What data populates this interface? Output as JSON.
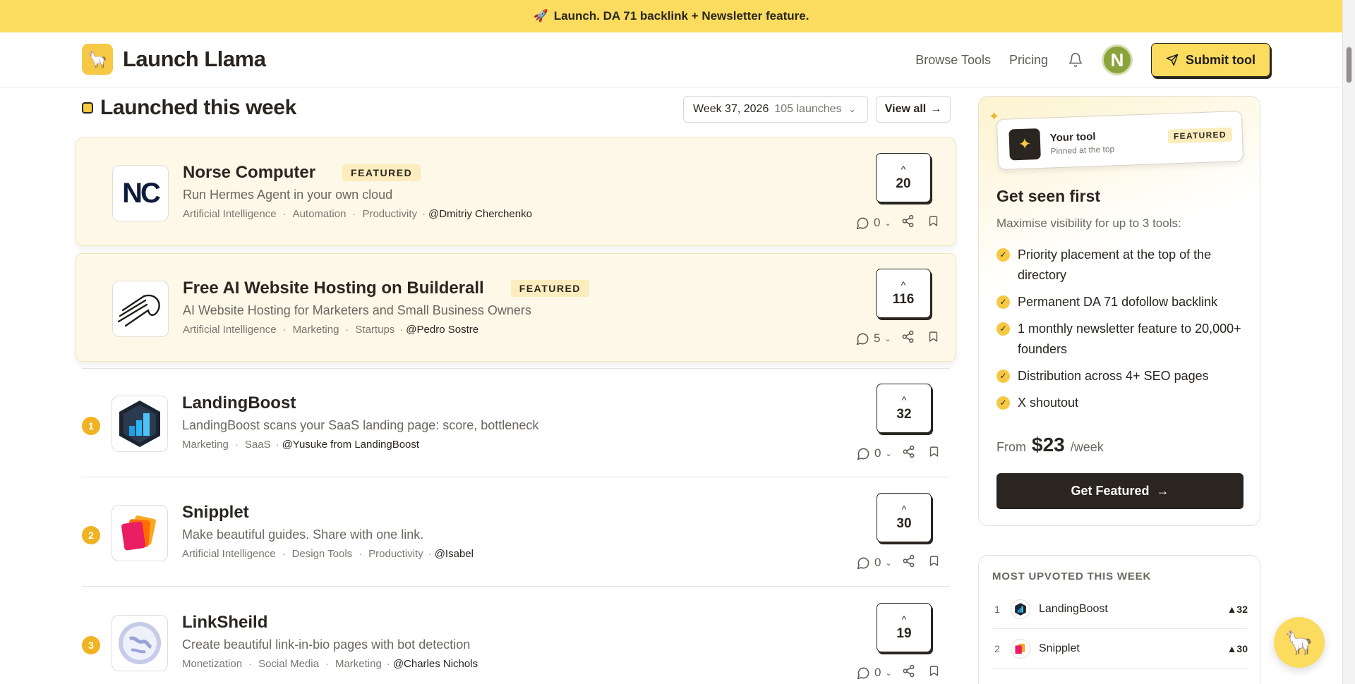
{
  "banner": {
    "icon": "rocket-icon",
    "text": "Launch. DA 71 backlink + Newsletter feature."
  },
  "header": {
    "brand": "Launch Llama",
    "nav": {
      "browse": "Browse Tools",
      "pricing": "Pricing"
    },
    "avatar_initial": "N",
    "submit_label": "Submit tool"
  },
  "section": {
    "title": "Launched this week",
    "week_label": "Week 37, 2026",
    "week_count": "105 launches",
    "view_all": "View all"
  },
  "launches": [
    {
      "name": "Norse Computer",
      "badge": "FEATURED",
      "tagline": "Run Hermes Agent in your own cloud",
      "tags": [
        "Artificial Intelligence",
        "Automation",
        "Productivity"
      ],
      "author": "@Dmitriy Cherchenko",
      "votes": "20",
      "comments": "0"
    },
    {
      "name": "Free AI Website Hosting on Builderall",
      "badge": "FEATURED",
      "tagline": "AI Website Hosting for Marketers and Small Business Owners",
      "tags": [
        "Artificial Intelligence",
        "Marketing",
        "Startups"
      ],
      "author": "@Pedro Sostre",
      "votes": "116",
      "comments": "5"
    },
    {
      "rank": "1",
      "name": "LandingBoost",
      "tagline": "LandingBoost scans your SaaS landing page: score, bottleneck",
      "tags": [
        "Marketing",
        "SaaS"
      ],
      "author": "@Yusuke from LandingBoost",
      "votes": "32",
      "comments": "0"
    },
    {
      "rank": "2",
      "name": "Snipplet",
      "tagline": "Make beautiful guides. Share with one link.",
      "tags": [
        "Artificial Intelligence",
        "Design Tools",
        "Productivity"
      ],
      "author": "@Isabel",
      "votes": "30",
      "comments": "0"
    },
    {
      "rank": "3",
      "name": "LinkSheild",
      "tagline": "Create beautiful link-in-bio pages with bot detection",
      "tags": [
        "Monetization",
        "Social Media",
        "Marketing"
      ],
      "author": "@Charles Nichols",
      "votes": "19",
      "comments": "0"
    }
  ],
  "promo": {
    "mock_title": "Your tool",
    "mock_sub": "Pinned at the top",
    "mock_badge": "FEATURED",
    "title": "Get seen first",
    "subtitle": "Maximise visibility for up to 3 tools:",
    "benefits": [
      "Priority placement at the top of the directory",
      "Permanent DA 71 dofollow backlink",
      "1 monthly newsletter feature to 20,000+ founders",
      "Distribution across 4+ SEO pages",
      "X shoutout"
    ],
    "price_prefix": "From",
    "price": "$23",
    "price_suffix": "/week",
    "cta": "Get Featured"
  },
  "most_upvoted": {
    "title": "MOST UPVOTED THIS WEEK",
    "items": [
      {
        "rank": "1",
        "name": "LandingBoost",
        "count": "▲32"
      },
      {
        "rank": "2",
        "name": "Snipplet",
        "count": "▲30"
      }
    ]
  },
  "colors": {
    "accent": "#fbdc5f",
    "dark": "#2a2520",
    "featured_bg": "#fdf8e8",
    "rank_badge": "#f0b323"
  }
}
